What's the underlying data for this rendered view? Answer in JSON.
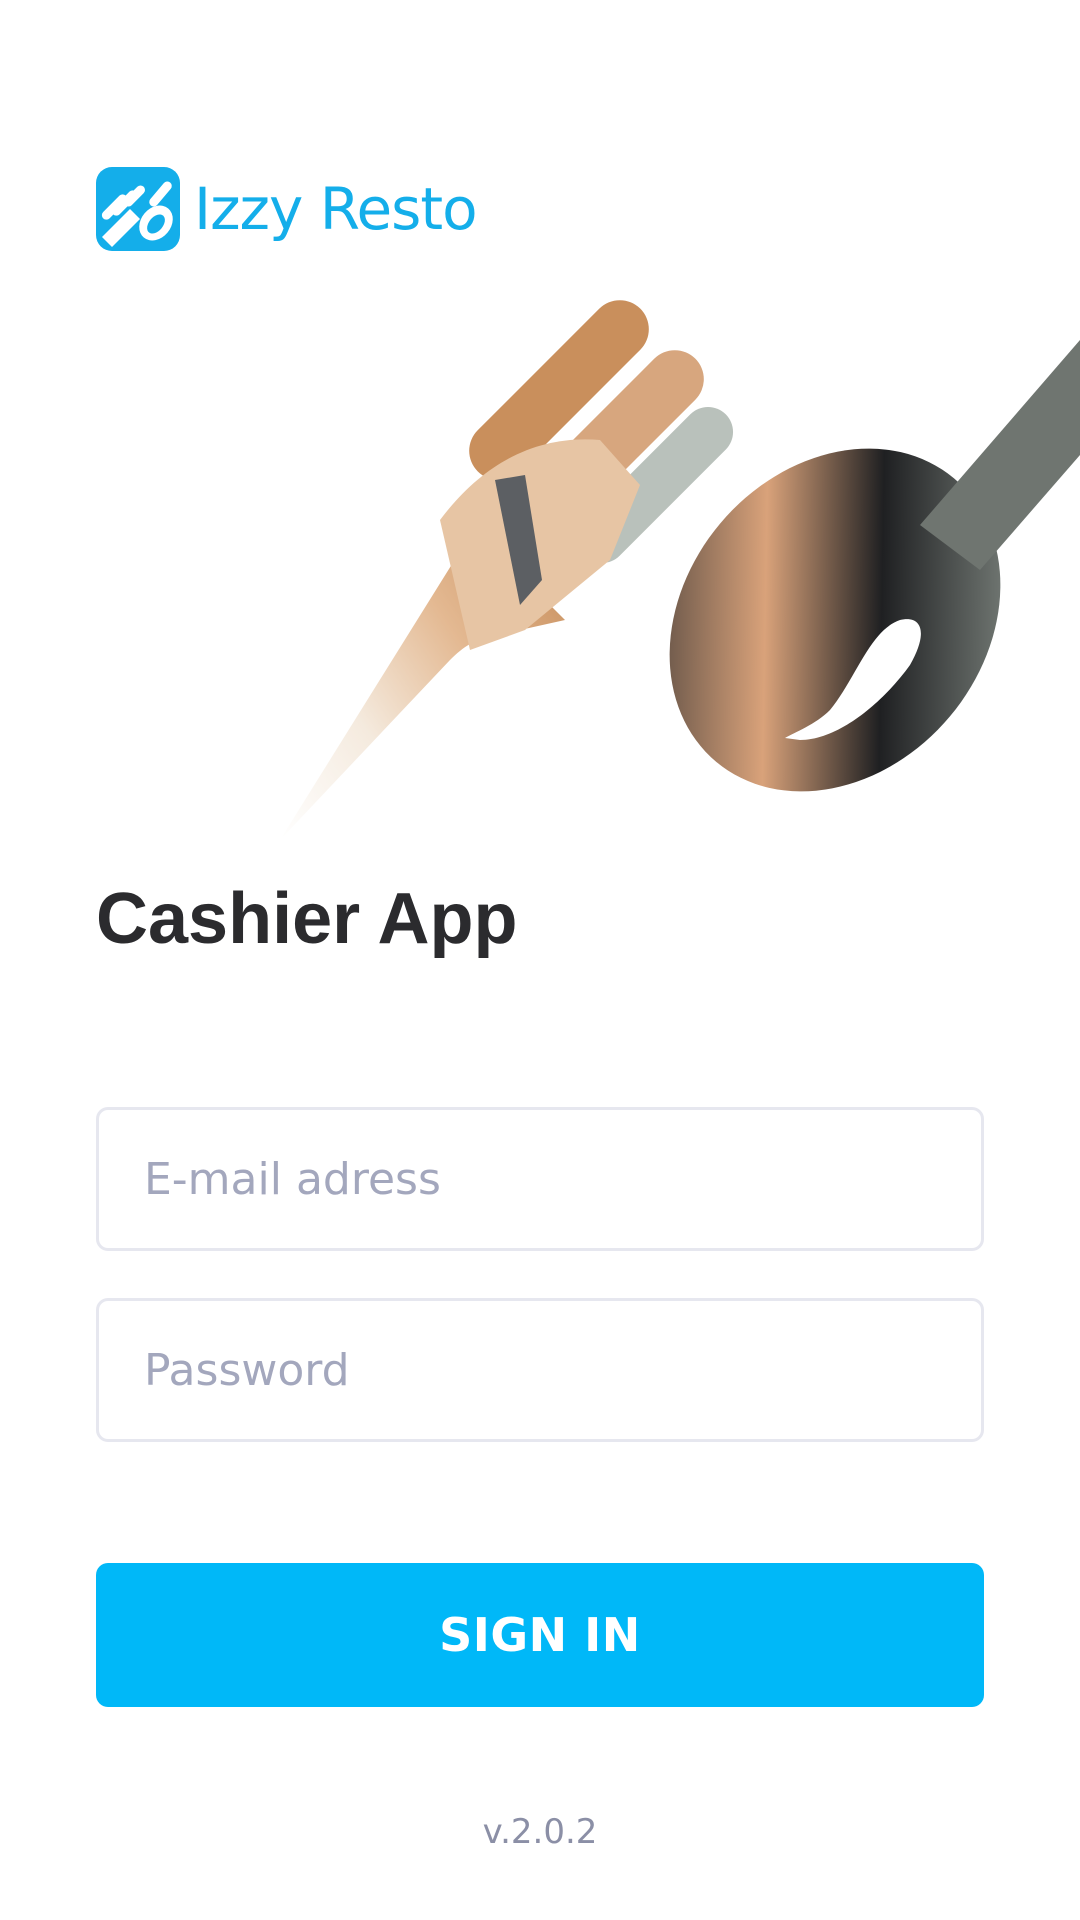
{
  "brand": {
    "name": "Izzy Resto",
    "logo_icon": "fork-spoon-icon",
    "color": "#14aeea"
  },
  "hero": {
    "icon": "fork-spoon-illustration",
    "description_hidden": true
  },
  "page": {
    "title": "Cashier App"
  },
  "form": {
    "email_placeholder": "E-mail adress",
    "email_value": "",
    "password_placeholder": "Password",
    "password_value": "",
    "submit_label": "SIGN IN"
  },
  "footer": {
    "version": "v.2.0.2"
  },
  "colors": {
    "accent": "#00b8f8",
    "title": "#2b2b2e",
    "placeholder": "#a3a7bd",
    "field_border": "#e6e7ef",
    "version_text": "#8b8fa6"
  }
}
